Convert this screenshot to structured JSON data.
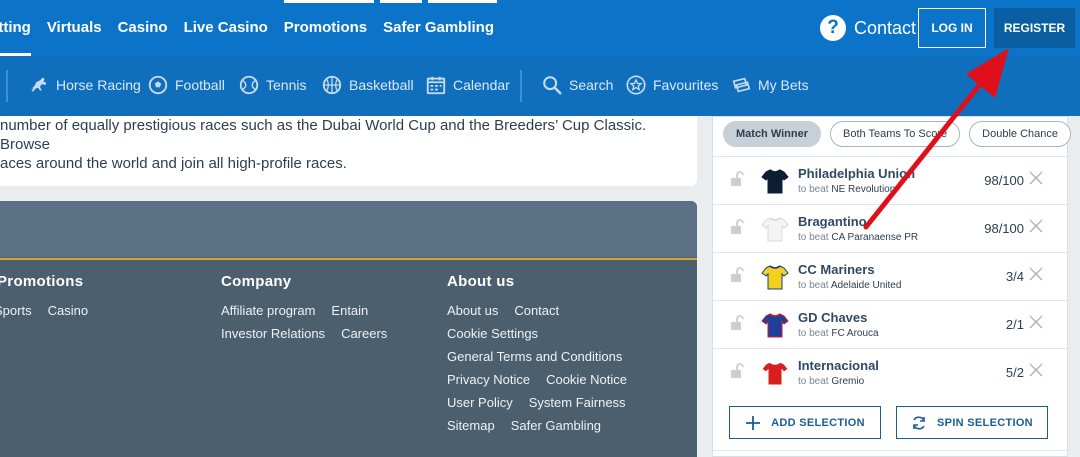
{
  "topnav": {
    "items": [
      {
        "label": "etting"
      },
      {
        "label": "Virtuals"
      },
      {
        "label": "Casino"
      },
      {
        "label": "Live Casino"
      },
      {
        "label": "Promotions"
      },
      {
        "label": "Safer Gambling"
      }
    ],
    "contact_label": "Contact",
    "login_label": "LOG IN",
    "register_label": "REGISTER"
  },
  "subnav": {
    "items": [
      {
        "label": "Horse Racing",
        "icon": "horse-icon"
      },
      {
        "label": "Football",
        "icon": "football-icon"
      },
      {
        "label": "Tennis",
        "icon": "tennis-icon"
      },
      {
        "label": "Basketball",
        "icon": "basketball-icon"
      },
      {
        "label": "Calendar",
        "icon": "calendar-icon"
      },
      {
        "label": "Search",
        "icon": "search-icon"
      },
      {
        "label": "Favourites",
        "icon": "star-icon"
      },
      {
        "label": "My Bets",
        "icon": "bets-icon"
      }
    ]
  },
  "content": {
    "line1": "number of equally prestigious races such as the Dubai World Cup and the Breeders’ Cup Classic. Browse",
    "line2": "aces around the world and join all high-profile races."
  },
  "footer": {
    "columns": [
      {
        "title": "Promotions",
        "links": [
          "Sports",
          "Casino"
        ]
      },
      {
        "title": "Company",
        "links": [
          "Affiliate program",
          "Entain",
          "Investor Relations",
          "Careers"
        ]
      },
      {
        "title": "About us",
        "links": [
          "About us",
          "Contact",
          "Cookie Settings",
          "General Terms and Conditions",
          "Privacy Notice",
          "Cookie Notice",
          "User Policy",
          "System Fairness",
          "Sitemap",
          "Safer Gambling"
        ]
      }
    ]
  },
  "betbuilder": {
    "chips": [
      "Match Winner",
      "Both Teams To Score",
      "Double Chance"
    ],
    "to_beat_label": "to beat",
    "selections": [
      {
        "team": "Philadelphia Union",
        "opponent": "NE Revolution",
        "odds": "98/100",
        "shirt_color": "#0b1e33",
        "trim": "#0b1e33"
      },
      {
        "team": "Bragantino",
        "opponent": "CA Paranaense PR",
        "odds": "98/100",
        "shirt_color": "#f4f4f4",
        "trim": "#d8d8d8"
      },
      {
        "team": "CC Mariners",
        "opponent": "Adelaide United",
        "odds": "3/4",
        "shirt_color": "#f2d21c",
        "trim": "#1b3a8a"
      },
      {
        "team": "GD Chaves",
        "opponent": "FC Arouca",
        "odds": "2/1",
        "shirt_color": "#1e3e9a",
        "trim": "#c8202a"
      },
      {
        "team": "Internacional",
        "opponent": "Gremio",
        "odds": "5/2",
        "shirt_color": "#d81e1e",
        "trim": "#ffffff"
      }
    ],
    "add_label": "ADD SELECTION",
    "spin_label": "SPIN SELECTION"
  },
  "colors": {
    "topbar": "#0b74c8",
    "subbar": "#0f6fbd",
    "register": "#0a5fa3",
    "footer": "#4b5f6f",
    "accent_arrow": "#e0101a"
  }
}
